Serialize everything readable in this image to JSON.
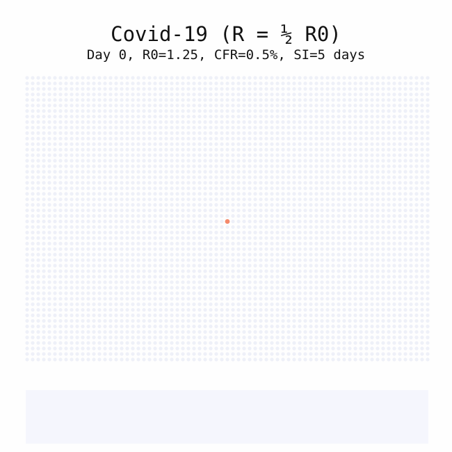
{
  "header": {
    "title": "Covid-19 (R = ½ R0)",
    "subtitle": "Day 0, R0=1.25, CFR=0.5%, SI=5 days"
  },
  "simulation": {
    "day": 0,
    "population_grid": {
      "columns": 73,
      "rows": 52
    },
    "infected": 1,
    "colors": {
      "susceptible": "#eef0f8",
      "infected": "#f4896b",
      "panel": "#f5f6fd"
    }
  }
}
